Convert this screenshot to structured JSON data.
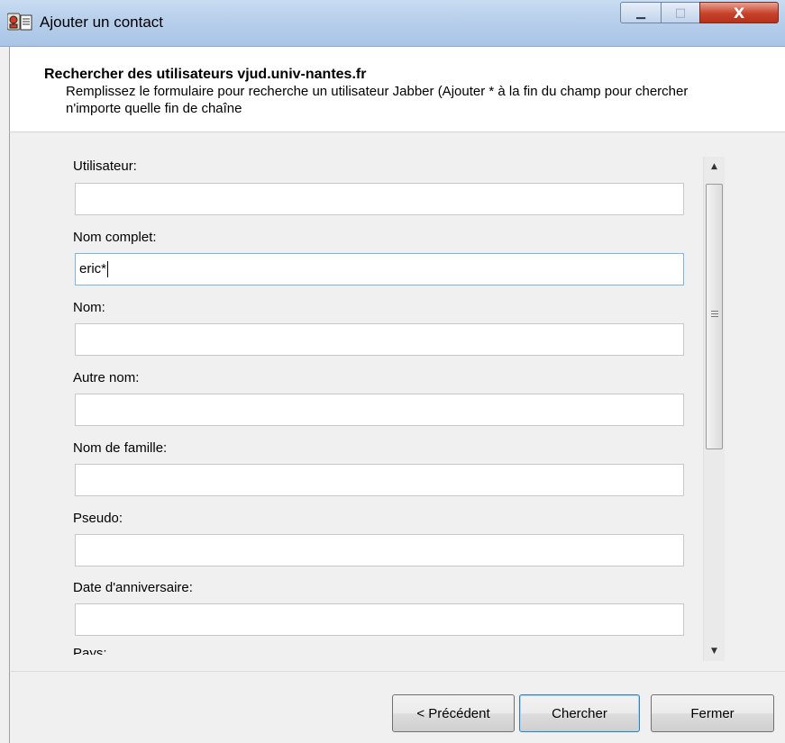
{
  "window": {
    "title": "Ajouter un contact",
    "controls": {
      "minimize": "▁",
      "maximize": "□",
      "close": "X"
    }
  },
  "header": {
    "title": "Rechercher des utilisateurs vjud.univ-nantes.fr",
    "description": "Remplissez le formulaire pour recherche un utilisateur Jabber (Ajouter * à la fin du champ pour chercher n'importe quelle fin de chaîne"
  },
  "form": {
    "fields": [
      {
        "label": "Utilisateur:",
        "value": ""
      },
      {
        "label": "Nom complet:",
        "value": "eric*"
      },
      {
        "label": "Nom:",
        "value": ""
      },
      {
        "label": "Autre nom:",
        "value": ""
      },
      {
        "label": "Nom de famille:",
        "value": ""
      },
      {
        "label": "Pseudo:",
        "value": ""
      },
      {
        "label": "Date d'anniversaire:",
        "value": ""
      },
      {
        "label": "Pays:",
        "value": ""
      }
    ]
  },
  "buttons": {
    "previous": "< Précédent",
    "search": "Chercher",
    "close": "Fermer"
  },
  "colors": {
    "title_bar": "#b7cfeb",
    "close_button": "#c8412a",
    "focus_border": "#7eb4ea"
  }
}
